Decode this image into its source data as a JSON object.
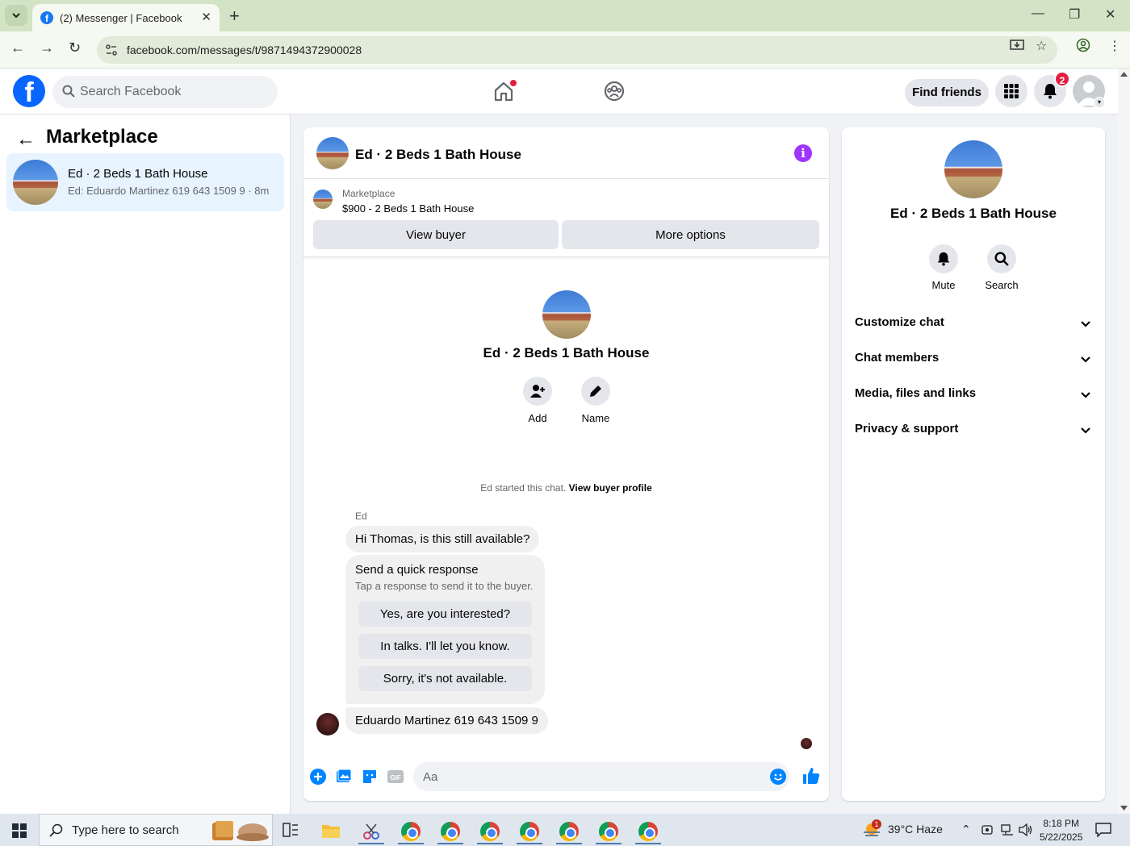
{
  "browser": {
    "tab_title": "(2) Messenger | Facebook",
    "url": "facebook.com/messages/t/9871494372900028"
  },
  "fb": {
    "search_placeholder": "Search Facebook",
    "find_friends": "Find friends",
    "notification_count": "2"
  },
  "sidebar": {
    "title": "Marketplace",
    "conversations": [
      {
        "name": "Ed · 2 Beds 1 Bath House",
        "preview": "Ed: Eduardo Martinez 619 643 1509 9 · 8m"
      }
    ]
  },
  "chat": {
    "title": "Ed · 2 Beds 1 Bath House",
    "marketplace_label": "Marketplace",
    "listing": "$900 - 2 Beds 1 Bath House",
    "view_buyer": "View buyer",
    "more_options": "More options",
    "intro_name": "Ed · 2 Beds 1 Bath House",
    "add_label": "Add",
    "name_label": "Name",
    "started_text": "Ed started this chat.",
    "view_buyer_profile": "View buyer profile",
    "sender": "Ed",
    "message1": "Hi Thomas, is this still available?",
    "quick_title": "Send a quick response",
    "quick_sub": "Tap a response to send it to the buyer.",
    "quick_responses": [
      "Yes, are you interested?",
      "In talks. I'll let you know.",
      "Sorry, it's not available."
    ],
    "message2": "Eduardo Martinez 619 643 1509 9",
    "composer_placeholder": "Aa"
  },
  "details": {
    "name": "Ed · 2 Beds 1 Bath House",
    "mute": "Mute",
    "search": "Search",
    "sections": [
      "Customize chat",
      "Chat members",
      "Media, files and links",
      "Privacy & support"
    ]
  },
  "taskbar": {
    "search_placeholder": "Type here to search",
    "weather": "39°C  Haze",
    "weather_badge": "1",
    "time": "8:18 PM",
    "date": "5/22/2025"
  },
  "colors": {
    "fb_blue": "#0866ff",
    "accent_purple": "#a033ff",
    "messenger_blue": "#0084ff",
    "selected_bg": "#e7f3ff"
  }
}
